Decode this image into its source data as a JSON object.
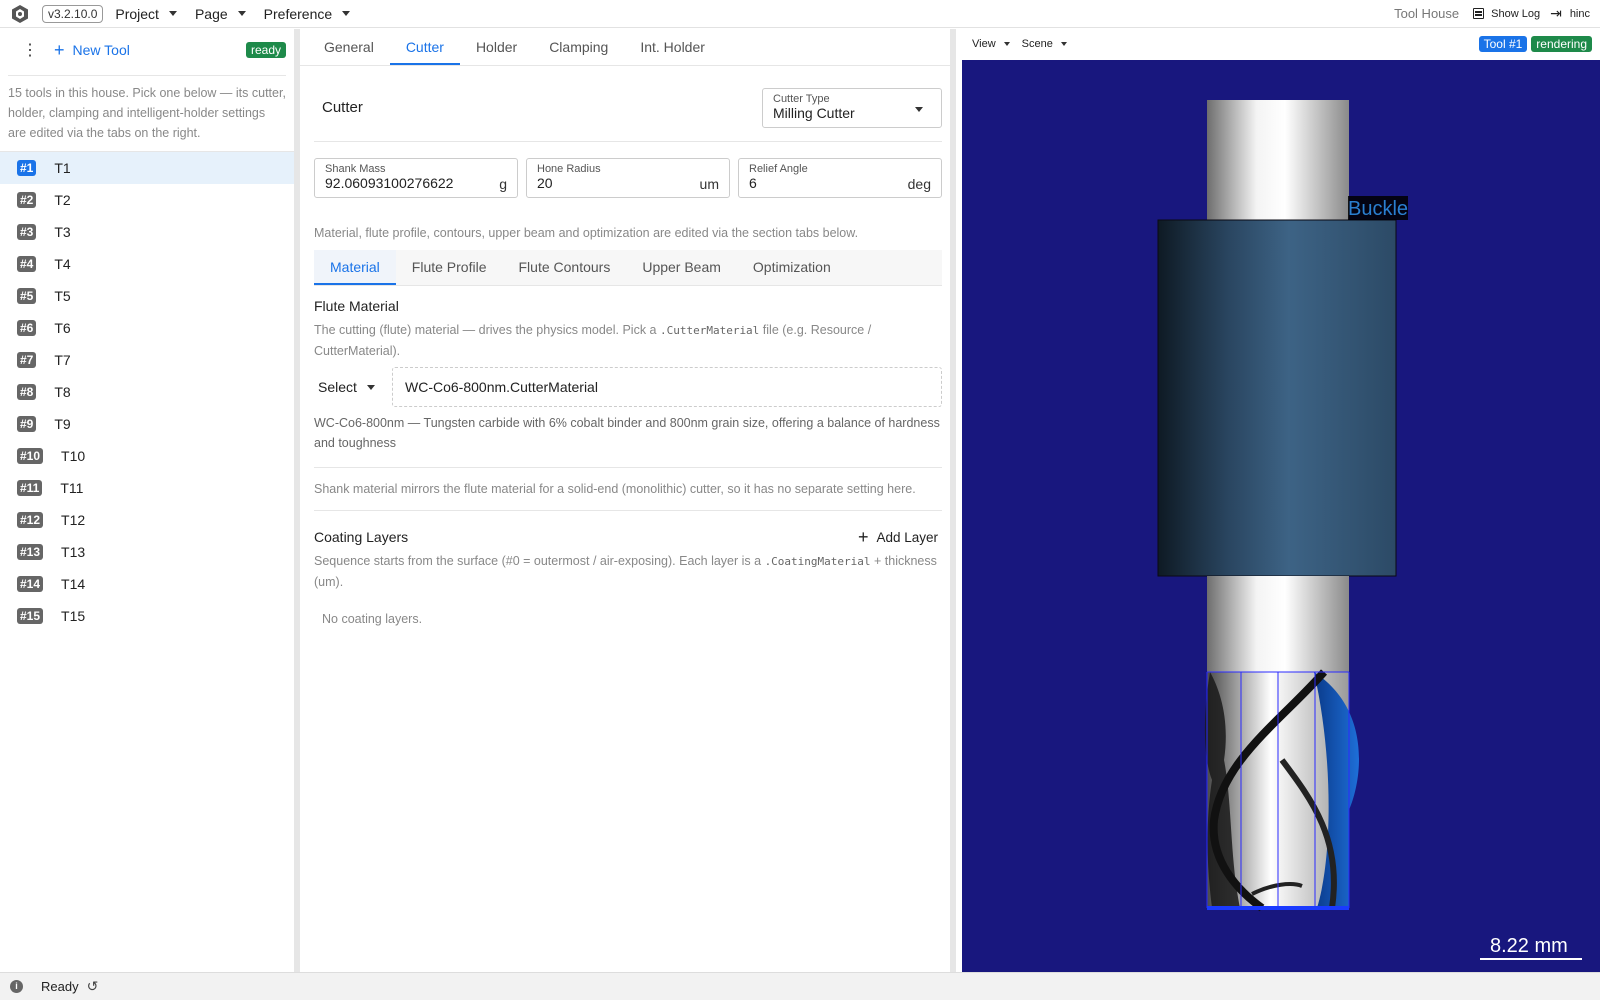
{
  "topbar": {
    "version": "v3.2.10.0",
    "menus": [
      {
        "label": "Project"
      },
      {
        "label": "Page"
      },
      {
        "label": "Preference"
      }
    ],
    "tool_house": "Tool House",
    "show_log": "Show Log",
    "user": "hinc"
  },
  "sidebar": {
    "new_tool": "New Tool",
    "status": "ready",
    "description": "15 tools in this house. Pick one below — its cutter, holder, clamping and intelligent-holder settings are edited via the tabs on the right.",
    "tools": [
      {
        "num": "#1",
        "name": "T1"
      },
      {
        "num": "#2",
        "name": "T2"
      },
      {
        "num": "#3",
        "name": "T3"
      },
      {
        "num": "#4",
        "name": "T4"
      },
      {
        "num": "#5",
        "name": "T5"
      },
      {
        "num": "#6",
        "name": "T6"
      },
      {
        "num": "#7",
        "name": "T7"
      },
      {
        "num": "#8",
        "name": "T8"
      },
      {
        "num": "#9",
        "name": "T9"
      },
      {
        "num": "#10",
        "name": "T10"
      },
      {
        "num": "#11",
        "name": "T11"
      },
      {
        "num": "#12",
        "name": "T12"
      },
      {
        "num": "#13",
        "name": "T13"
      },
      {
        "num": "#14",
        "name": "T14"
      },
      {
        "num": "#15",
        "name": "T15"
      }
    ]
  },
  "center": {
    "tabs": [
      {
        "label": "General"
      },
      {
        "label": "Cutter"
      },
      {
        "label": "Holder"
      },
      {
        "label": "Clamping"
      },
      {
        "label": "Int. Holder"
      }
    ],
    "active_tab": "Cutter",
    "cutter_title": "Cutter",
    "cutter_type": {
      "label": "Cutter Type",
      "value": "Milling Cutter"
    },
    "fields": [
      {
        "label": "Shank Mass",
        "value": "92.06093100276622",
        "unit": "g"
      },
      {
        "label": "Hone Radius",
        "value": "20",
        "unit": "um"
      },
      {
        "label": "Relief Angle",
        "value": "6",
        "unit": "deg"
      }
    ],
    "section_hint": "Material, flute profile, contours, upper beam and optimization are edited via the section tabs below.",
    "subtabs": [
      {
        "label": "Material"
      },
      {
        "label": "Flute Profile"
      },
      {
        "label": "Flute Contours"
      },
      {
        "label": "Upper Beam"
      },
      {
        "label": "Optimization"
      }
    ],
    "flute_material": {
      "title": "Flute Material",
      "desc_prefix": "The cutting (flute) material — drives the physics model. Pick a ",
      "desc_code": ".CutterMaterial",
      "desc_suffix": " file (e.g. Resource / CutterMaterial).",
      "select_label": "Select",
      "file": "WC-Co6-800nm.CutterMaterial",
      "material_desc": "WC-Co6-800nm — Tungsten carbide with 6% cobalt binder and 800nm grain size, offering a balance of hardness and toughness"
    },
    "shank_note": "Shank material mirrors the flute material for a solid-end (monolithic) cutter, so it has no separate setting here.",
    "coating": {
      "title": "Coating Layers",
      "add_label": "Add Layer",
      "desc_prefix": "Sequence starts from the surface (#0 = outermost / air-exposing). Each layer is a ",
      "desc_code": ".CoatingMaterial",
      "desc_suffix": " + thickness (um).",
      "empty": "No coating layers."
    }
  },
  "viewport": {
    "view_menu": "View",
    "scene_menu": "Scene",
    "tool_badge": "Tool #1",
    "render_badge": "rendering",
    "buckle_label": "Buckle",
    "scale": "8.22 mm",
    "colors": {
      "background": "#18177e",
      "collar": "#2f4f6b",
      "shank": "#d9d9d9"
    }
  },
  "status": {
    "text": "Ready"
  }
}
